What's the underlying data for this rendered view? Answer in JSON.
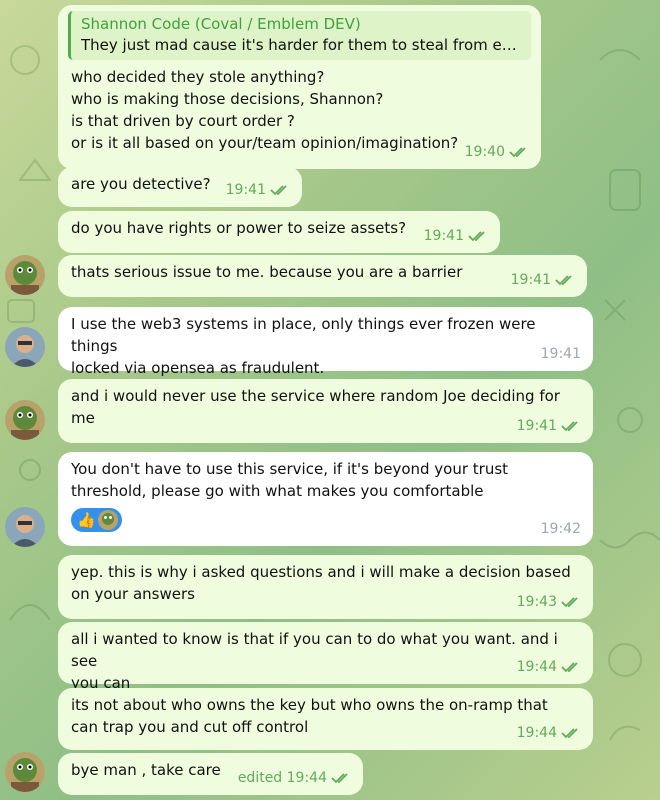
{
  "messages": [
    {
      "id": "m1",
      "dir": "out",
      "reply": {
        "author": "Shannon Code (Coval / Emblem DEV)",
        "text": "They just mad cause it's harder for them to steal from eve..."
      },
      "text": "who decided they stole anything?\nwho is making those decisions, Shannon?\nis that driven by court order ?\nor is it all based on your/team opinion/imagination?",
      "time": "19:40",
      "read": true
    },
    {
      "id": "m2",
      "dir": "out",
      "text": "are you detective?",
      "time": "19:41",
      "read": true
    },
    {
      "id": "m3",
      "dir": "out",
      "text": "do you have rights or power to seize assets?",
      "time": "19:41",
      "read": true
    },
    {
      "id": "m4",
      "dir": "out",
      "text": "thats serious issue to me. because you are a barrier",
      "time": "19:41",
      "read": true,
      "avatar": "frog-avatar"
    },
    {
      "id": "m5",
      "dir": "in",
      "text": "I use the web3 systems in place, only things ever frozen were things\nlocked via opensea as fraudulent.",
      "time": "19:41",
      "avatar": "man-avatar"
    },
    {
      "id": "m6",
      "dir": "out",
      "text": "and i would never use the service where random Joe deciding for\nme",
      "time": "19:41",
      "read": true,
      "avatar": "frog-avatar"
    },
    {
      "id": "m7",
      "dir": "in",
      "text": "You don't have to use this service, if it's beyond your trust\nthreshold, please go with what makes you comfortable",
      "time": "19:42",
      "avatar": "man-avatar",
      "reaction": {
        "emoji": "👍",
        "icon": "thumbs-up-icon"
      }
    },
    {
      "id": "m8",
      "dir": "out",
      "text": "yep. this is why i asked questions and i will make a decision based\non your answers",
      "time": "19:43",
      "read": true
    },
    {
      "id": "m9",
      "dir": "out",
      "text": "all i wanted to know is that if you can to do what you want. and i see\nyou can",
      "time": "19:44",
      "read": true
    },
    {
      "id": "m10",
      "dir": "out",
      "text": "its not about who owns the key but who owns the on-ramp that\ncan trap you and cut off control",
      "time": "19:44",
      "read": true
    },
    {
      "id": "m11",
      "dir": "out",
      "text": "bye man , take care",
      "time": "edited 19:44",
      "read": true,
      "avatar": "frog-avatar"
    }
  ],
  "colors": {
    "outgoing_bubble": "#effdde",
    "incoming_bubble": "#ffffff",
    "read_check": "#62ab5a",
    "reply_accent": "#4fae4e",
    "reaction_bg": "#3390ec"
  }
}
